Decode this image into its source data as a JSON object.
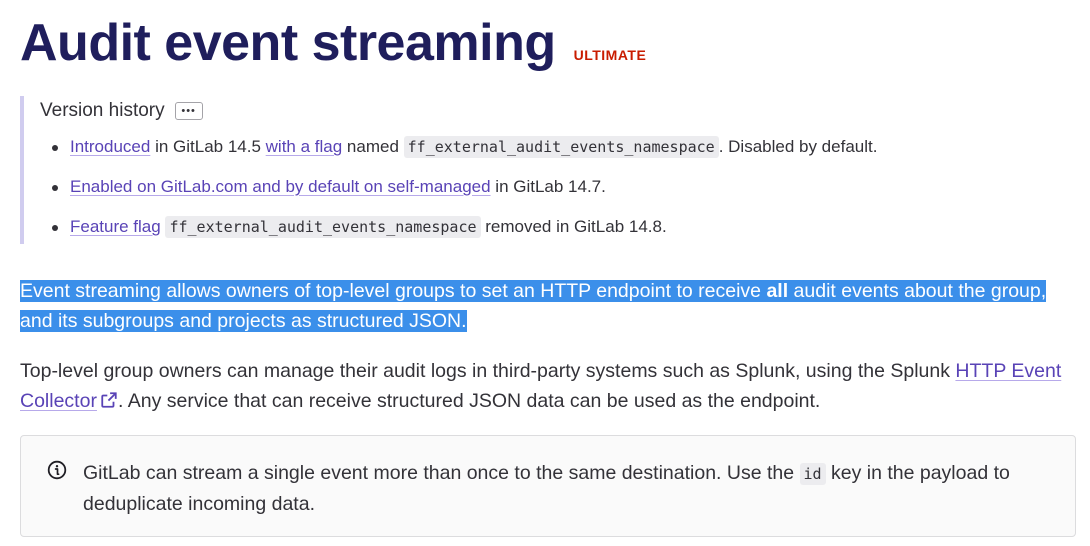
{
  "header": {
    "title": "Audit event streaming",
    "tier": "ULTIMATE"
  },
  "version_history": {
    "label": "Version history",
    "more_label": "•••",
    "items": [
      {
        "link1": "Introduced",
        "t1": " in GitLab 14.5 ",
        "link2": "with a flag",
        "t2": " named ",
        "code": "ff_external_audit_events_namespace",
        "t3": ". Disabled by default."
      },
      {
        "link1": "Enabled on GitLab.com and by default on self-managed",
        "t1": " in GitLab 14.7."
      },
      {
        "link1": "Feature flag",
        "t1": " ",
        "code": "ff_external_audit_events_namespace",
        "t2": " removed in GitLab 14.8."
      }
    ]
  },
  "intro": {
    "before": "Event streaming allows owners of top-level groups to set an HTTP endpoint to receive ",
    "bold": "all",
    "after": " audit events about the group, and its subgroups and projects as structured JSON."
  },
  "para2": {
    "before": "Top-level group owners can manage their audit logs in third-party systems such as Splunk, using the Splunk ",
    "link": "HTTP Event Collector",
    "after": ". Any service that can receive structured JSON data can be used as the endpoint."
  },
  "note": {
    "icon": "info-icon",
    "before": "GitLab can stream a single event more than once to the same destination. Use the ",
    "code": "id",
    "after": " key in the payload to deduplicate incoming data."
  },
  "colors": {
    "title": "#1f1e5c",
    "tier": "#c91c00",
    "link": "#5943b6",
    "highlight": "#3b8fea",
    "vh_border": "#d0ccef"
  }
}
